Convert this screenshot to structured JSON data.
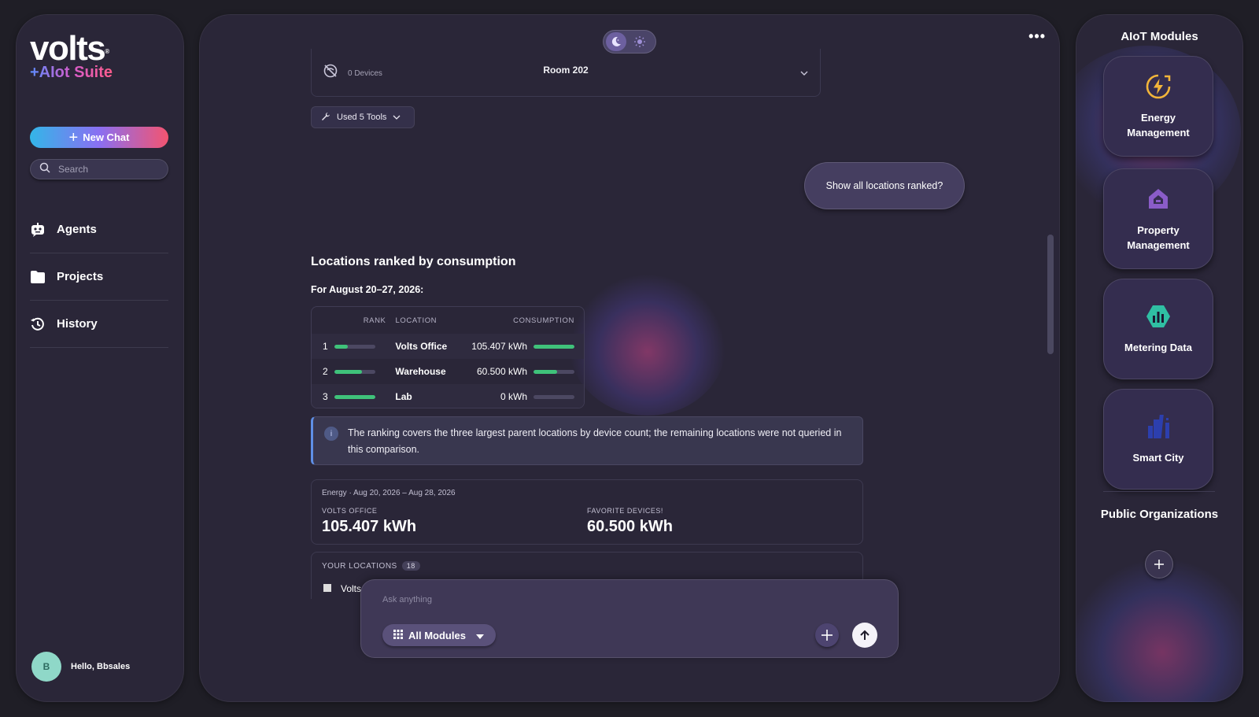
{
  "sidebar": {
    "logo": {
      "main": "volts",
      "mark": "®",
      "sub": "+AIot Suite"
    },
    "new_chat_label": "New Chat",
    "search_placeholder": "Search",
    "nav": [
      {
        "label": "Agents",
        "icon": "robot-icon"
      },
      {
        "label": "Projects",
        "icon": "folder-icon"
      },
      {
        "label": "History",
        "icon": "history-icon"
      }
    ],
    "user": {
      "initial": "B",
      "greeting": "Hello, Bbsales"
    }
  },
  "main": {
    "theme_toggle": {
      "active": "dark",
      "icons": [
        "moon-icon",
        "sun-icon"
      ]
    },
    "more_menu": "•••",
    "room_card": {
      "title": "Room 202",
      "subtitle": "0 Devices"
    },
    "tools_button": "Used 5 Tools",
    "user_message": "Show all locations ranked?",
    "response": {
      "title": "Locations ranked by consumption",
      "subtitle": "For August 20–27, 2026:",
      "table": {
        "headers": [
          "RANK",
          "LOCATION",
          "CONSUMPTION"
        ],
        "rows": [
          {
            "rank": "1",
            "location": "Volts Office",
            "consumption": "105.407 kWh",
            "rank_fill": 0.33,
            "cons_fill": 1.0
          },
          {
            "rank": "2",
            "location": "Warehouse",
            "consumption": "60.500 kWh",
            "rank_fill": 0.67,
            "cons_fill": 0.57
          },
          {
            "rank": "3",
            "location": "Lab",
            "consumption": "0 kWh",
            "rank_fill": 1.0,
            "cons_fill": 0.0
          }
        ]
      },
      "info_note": "The ranking covers the three largest parent locations by device count; the remaining locations were not queried in this comparison.",
      "energy_card": {
        "header": "Energy · Aug 20, 2026 – Aug 28, 2026",
        "metrics": [
          {
            "label": "VOLTS OFFICE",
            "value": "105.407 kWh"
          },
          {
            "label": "FAVORITE DEVICES!",
            "value": "60.500 kWh"
          }
        ]
      },
      "locations_card": {
        "label": "YOUR LOCATIONS",
        "count": "18",
        "first_item": "Volts Office"
      }
    },
    "composer": {
      "placeholder": "Ask anything",
      "module_select": "All Modules"
    }
  },
  "right_panel": {
    "title": "AIoT Modules",
    "modules": [
      {
        "label": "Energy Management",
        "icon": "energy-bolt-icon",
        "color": "#f2b53a"
      },
      {
        "label": "Property Management",
        "icon": "property-house-icon",
        "color": "#8a5cc8"
      },
      {
        "label": "Metering Data",
        "icon": "metering-chart-icon",
        "color": "#2fbfa3"
      },
      {
        "label": "Smart City",
        "icon": "city-buildings-icon",
        "color": "#2c3fae"
      }
    ],
    "public_orgs_title": "Public Organizations"
  },
  "colors": {
    "background": "#1f1e26",
    "panel": "#2a2638",
    "accent_green": "#3fc27a",
    "info_accent": "#5f8fe6"
  }
}
